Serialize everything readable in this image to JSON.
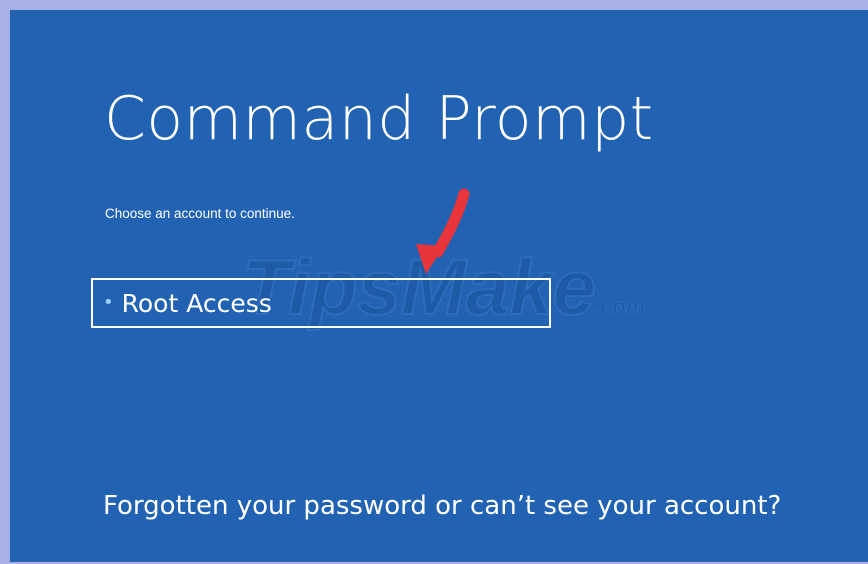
{
  "screen": {
    "title": "Command Prompt",
    "subtitle": "Choose an account to continue.",
    "accounts": [
      {
        "label": "Root Access",
        "selected": true
      }
    ],
    "footer_link": "Forgotten your password or can’t see your account?"
  },
  "overlay": {
    "watermark_main": "TipsMake",
    "watermark_suffix": ".com",
    "arrow_color": "#e8343a"
  },
  "colors": {
    "background": "#2262b3",
    "text": "#ffffff",
    "bullet": "#9ad0ff",
    "frame": "#a8b0e6"
  }
}
